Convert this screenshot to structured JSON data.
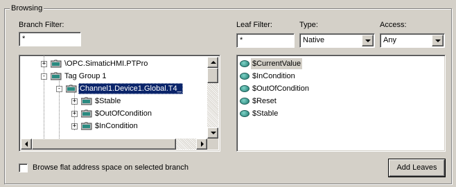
{
  "group": {
    "title": "Browsing"
  },
  "branch_filter": {
    "label": "Branch Filter:",
    "value": "*"
  },
  "leaf_filter": {
    "label": "Leaf Filter:",
    "value": "*"
  },
  "type": {
    "label": "Type:",
    "selected": "Native"
  },
  "access": {
    "label": "Access:",
    "selected": "Any"
  },
  "tree": {
    "items": [
      {
        "label": "\\OPC.SimaticHMI.PTPro",
        "expander": "+"
      },
      {
        "label": "Tag Group 1",
        "expander": "-"
      },
      {
        "label": "Channel1.Device1.Global.T4_",
        "expander": "-"
      },
      {
        "label": "$Stable",
        "expander": "+"
      },
      {
        "label": "$OutOfCondition",
        "expander": "+"
      },
      {
        "label": "$InCondition",
        "expander": "+"
      }
    ]
  },
  "leaves": {
    "items": [
      "$CurrentValue",
      "$InCondition",
      "$OutOfCondition",
      "$Reset",
      "$Stable"
    ]
  },
  "flat_browse": {
    "label": "Browse flat address space on selected branch",
    "checked": false
  },
  "add_leaves": {
    "label": "Add Leaves"
  },
  "colors": {
    "face": "#d4d0c8",
    "selection": "#0a246a",
    "leaf_icon": "#1f7a70"
  },
  "icons": {
    "folder": "folder-icon",
    "leaf": "tag-icon",
    "folder_open": "folder-open-icon"
  }
}
